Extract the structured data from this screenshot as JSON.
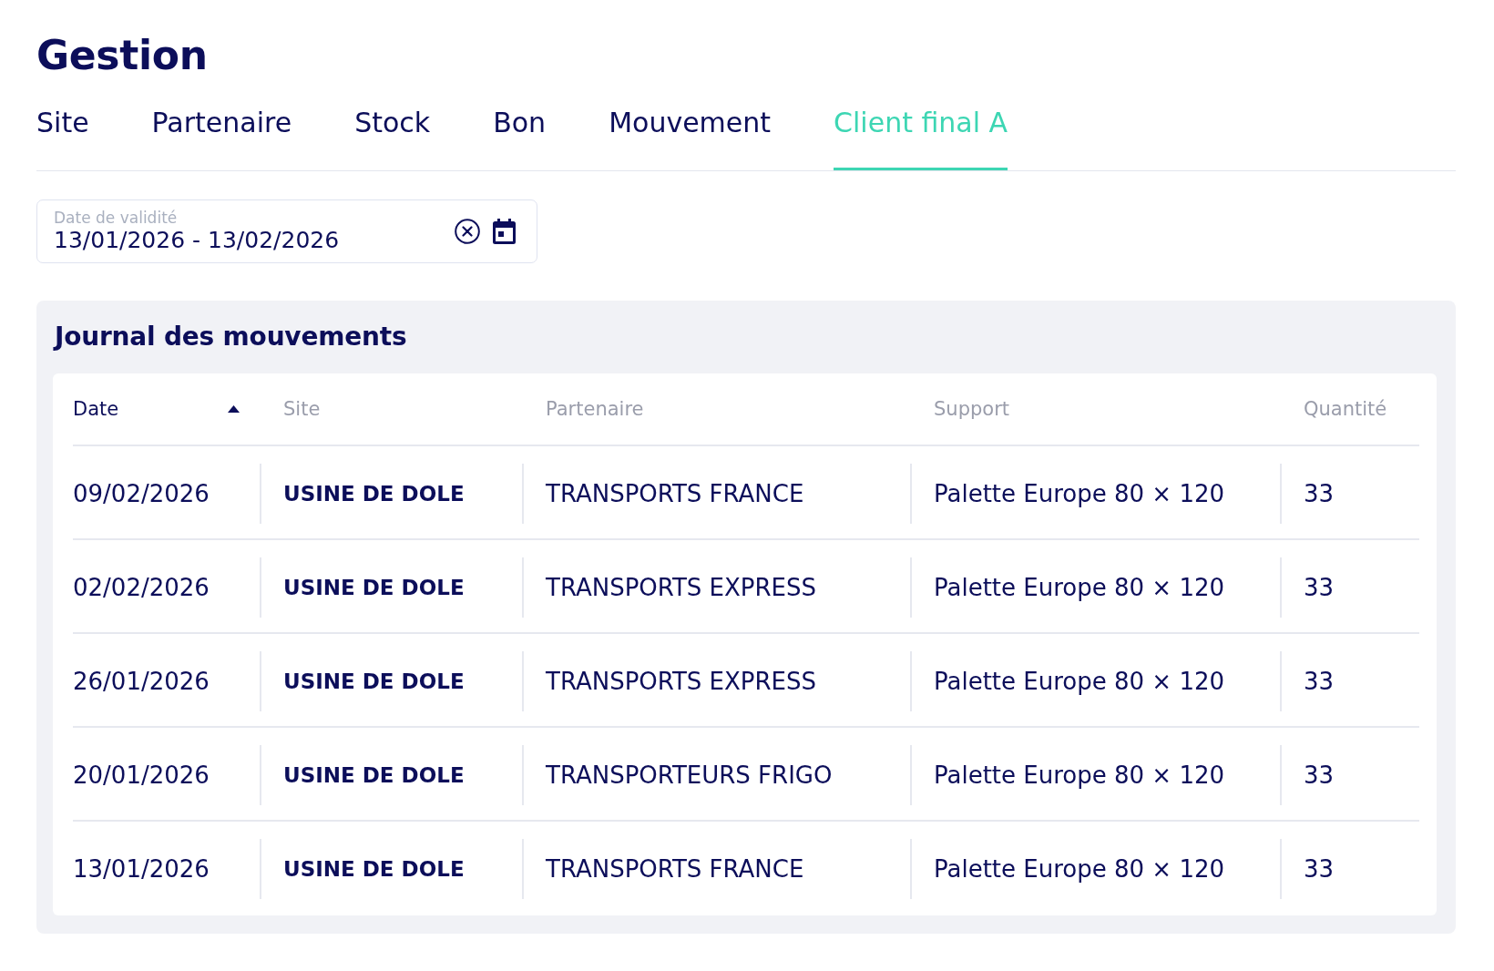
{
  "title": "Gestion",
  "tabs": [
    {
      "label": "Site",
      "selected": false
    },
    {
      "label": "Partenaire",
      "selected": false
    },
    {
      "label": "Stock",
      "selected": false
    },
    {
      "label": "Bon",
      "selected": false
    },
    {
      "label": "Mouvement",
      "selected": false
    },
    {
      "label": "Client final A",
      "selected": true
    }
  ],
  "date_filter": {
    "label": "Date de validité",
    "value": "13/01/2026 - 13/02/2026"
  },
  "journal": {
    "title": "Journal des mouvements",
    "columns": [
      {
        "label": "Date",
        "sorted": true
      },
      {
        "label": "Site",
        "sorted": false
      },
      {
        "label": "Partenaire",
        "sorted": false
      },
      {
        "label": "Support",
        "sorted": false
      },
      {
        "label": "Quantité",
        "sorted": false
      }
    ],
    "rows": [
      [
        "09/02/2026",
        "USINE DE DOLE",
        "TRANSPORTS FRANCE",
        "Palette Europe 80 × 120",
        "33"
      ],
      [
        "02/02/2026",
        "USINE DE DOLE",
        "TRANSPORTS EXPRESS",
        "Palette Europe 80 × 120",
        "33"
      ],
      [
        "26/01/2026",
        "USINE DE DOLE",
        "TRANSPORTS EXPRESS",
        "Palette Europe 80 × 120",
        "33"
      ],
      [
        "20/01/2026",
        "USINE DE DOLE",
        "TRANSPORTEURS FRIGO",
        "Palette Europe 80 × 120",
        "33"
      ],
      [
        "13/01/2026",
        "USINE DE DOLE",
        "TRANSPORTS FRANCE",
        "Palette Europe 80 × 120",
        "33"
      ]
    ]
  }
}
